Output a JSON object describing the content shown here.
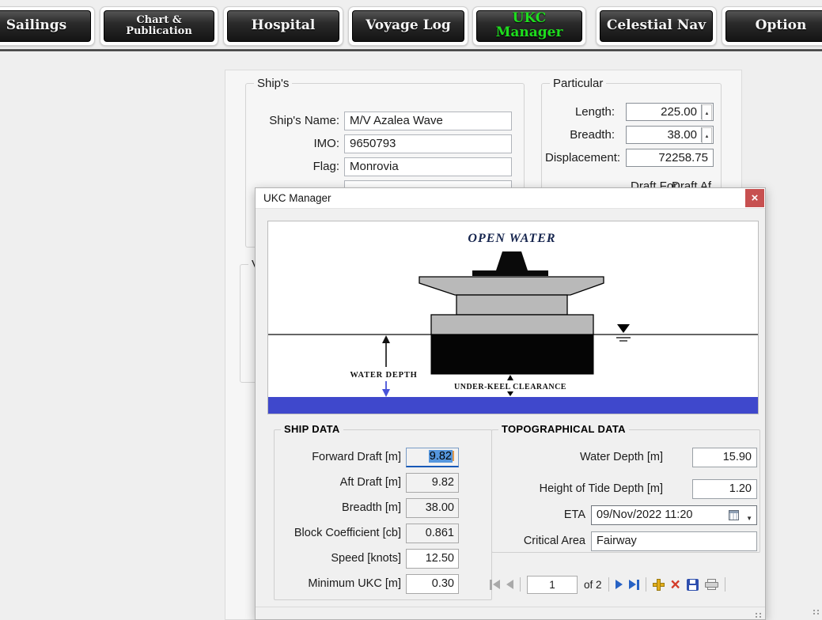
{
  "colors": {
    "accent_green": "#1ede1e",
    "close_button_red": "#c75050",
    "seabed_blue": "#3f48cc",
    "selection_blue": "#5596dd",
    "focus_underline_blue": "#1759b7"
  },
  "icons": {
    "up_arrow": "▲",
    "down_arrow": "▼",
    "close": "×",
    "delete": "×"
  },
  "nav": {
    "items": [
      {
        "label": "Sailings"
      },
      {
        "label": "Chart & Publication"
      },
      {
        "label": "Hospital"
      },
      {
        "label": "Voyage Log"
      },
      {
        "label": "UKC Manager",
        "active": true
      },
      {
        "label": "Celestial Nav"
      },
      {
        "label": "Option"
      }
    ]
  },
  "form": {
    "ships_group": {
      "title": "Ship's",
      "fields": [
        {
          "label": "Ship's Name:",
          "value": "M/V Azalea Wave"
        },
        {
          "label": "IMO:",
          "value": "9650793"
        },
        {
          "label": "Flag:",
          "value": "Monrovia"
        }
      ]
    },
    "particular_group": {
      "title": "Particular",
      "fields": [
        {
          "label": "Length:",
          "value": "225.00"
        },
        {
          "label": "Breadth:",
          "value": "38.00"
        },
        {
          "label": "Displacement:",
          "value": "72258.75"
        }
      ],
      "partial_labels": [
        "Draft For",
        "Draft Af"
      ]
    },
    "voyage_group_partial": "V"
  },
  "dialog": {
    "title": "UKC Manager",
    "diagram": {
      "title": "OPEN WATER",
      "water_depth_label": "WATER DEPTH",
      "ukc_label": "UNDER-KEEL CLEARANCE"
    },
    "ship_data": {
      "title": "SHIP DATA",
      "rows": [
        {
          "label": "Forward Draft [m]",
          "value": "9.82"
        },
        {
          "label": "Aft Draft [m]",
          "value": "9.82"
        },
        {
          "label": "Breadth [m]",
          "value": "38.00"
        },
        {
          "label": "Block Coefficient [cb]",
          "value": "0.861"
        },
        {
          "label": "Speed [knots]",
          "value": "12.50"
        },
        {
          "label": "Minimum UKC [m]",
          "value": "0.30"
        }
      ]
    },
    "topo_data": {
      "title": "TOPOGRAPHICAL DATA",
      "rows": [
        {
          "label": "Water Depth [m]",
          "value": "15.90"
        },
        {
          "label": "Height of Tide Depth [m]",
          "value": "1.20"
        },
        {
          "label": "ETA",
          "value": "09/Nov/2022 11:20"
        },
        {
          "label": "Critical Area",
          "value": "Fairway"
        }
      ]
    },
    "navigator": {
      "position": "1",
      "count_label": "of 2"
    }
  }
}
